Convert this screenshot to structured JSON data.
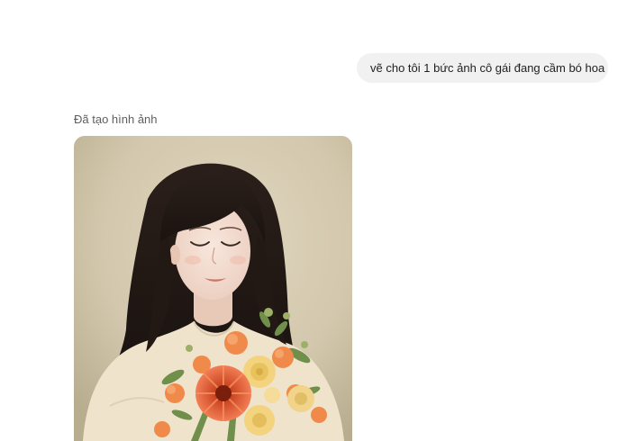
{
  "conversation": {
    "user_message": "vẽ cho tôi 1 bức ảnh cô gái đang cầm bó hoa",
    "assistant_status": "Đã tạo hình ảnh"
  },
  "generated_image": {
    "subject": "girl-holding-flower-bouquet"
  }
}
